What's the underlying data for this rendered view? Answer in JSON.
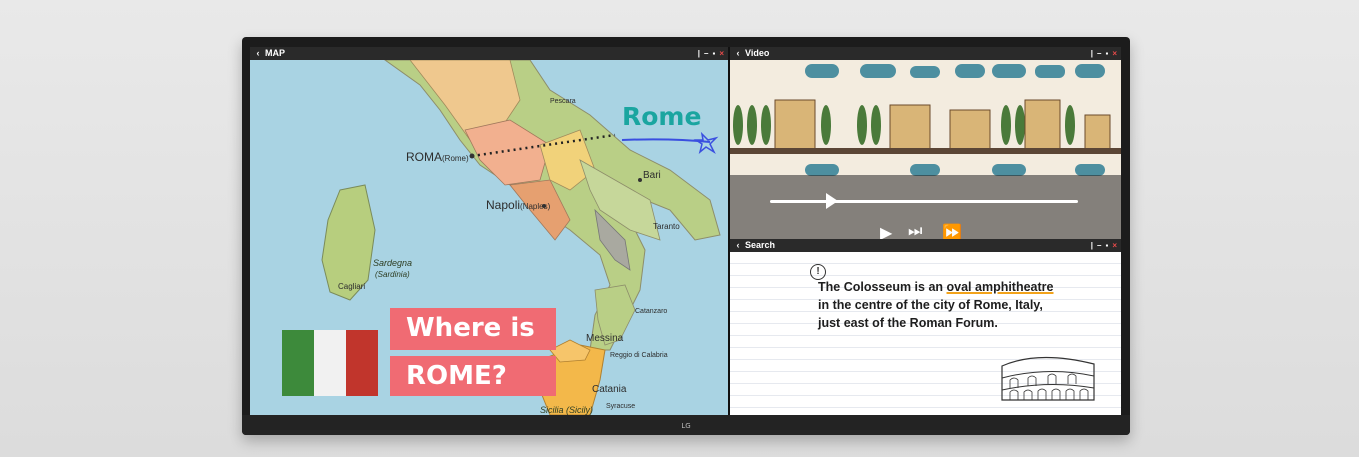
{
  "device": {
    "brand": "LG"
  },
  "map_window": {
    "title": "MAP",
    "controls": [
      "|",
      "–",
      "▪",
      "×"
    ],
    "cities": {
      "roma": "ROMA",
      "roma_en": "(Rome)",
      "napoli": "Napoli",
      "napoli_en": "(Naples)",
      "bari": "Bari",
      "messina": "Messina",
      "catania": "Catania",
      "cagliari": "Cagliari",
      "taranto": "Taranto",
      "catanzaro": "Catanzaro",
      "pescara": "Pescara",
      "reggio": "Reggio di Calabria",
      "syracuse": "Syracuse"
    },
    "regions": {
      "sardegna": "Sardegna",
      "sardinia": "(Sardinia)",
      "sicilia": "Sicilia (Sicily)"
    },
    "annotation": "Rome",
    "question_line1": "Where is",
    "question_line2": "ROME?",
    "flag_colors": [
      "#3d8a3b",
      "#f1f1f1",
      "#c1352c"
    ]
  },
  "video_window": {
    "title": "Video",
    "controls": [
      "|",
      "–",
      "▪",
      "×"
    ],
    "progress": 0.2,
    "buttons": {
      "play": "▶",
      "next": "⏭",
      "forward": "⏩"
    }
  },
  "search_window": {
    "title": "Search",
    "controls": [
      "|",
      "–",
      "▪",
      "×"
    ],
    "info_icon": "!",
    "line1_pre": "The Colosseum is an ",
    "line1_highlight": "oval amphitheatre",
    "line2": "in the centre of the city of Rome, Italy,",
    "line3": "just east of the Roman Forum."
  },
  "colors": {
    "accent_pink": "#f06b73",
    "annotation_teal": "#1aa5a0",
    "highlight": "#f2a31b",
    "close": "#e84a4a"
  }
}
